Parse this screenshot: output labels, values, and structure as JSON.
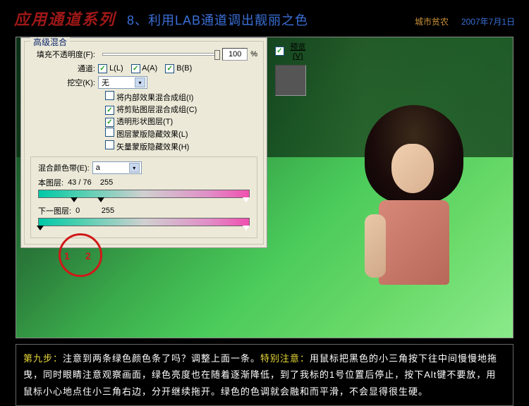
{
  "header": {
    "title_red": "应用通道系列",
    "title_blue": "8、利用LAB通道调出靓丽之色",
    "author": "城市贫农",
    "date": "2007年7月1日"
  },
  "dialog": {
    "group_title": "高级混合",
    "preview_label": "预览(V)",
    "fill_opacity_label": "填充不透明度(F):",
    "fill_opacity_value": "100",
    "percent": "%",
    "channels_label": "通道:",
    "ch_l": "L(L)",
    "ch_a": "A(A)",
    "ch_b": "B(B)",
    "knockout_label": "挖空(K):",
    "knockout_value": "无",
    "opt1": "将内部效果混合成组(I)",
    "opt2": "将剪贴图层混合成组(C)",
    "opt3": "透明形状图层(T)",
    "opt4": "图层蒙版隐藏效果(L)",
    "opt5": "矢量蒙版隐藏效果(H)",
    "blend_if_label": "混合颜色带(E):",
    "blend_if_value": "a",
    "this_layer": "本图层:",
    "this_vals": "43 / 76    255",
    "under_layer": "下一图层:",
    "under_vals": "0          255"
  },
  "annotations": {
    "m1": "1",
    "m2": "2"
  },
  "footer": {
    "step": "第九步：",
    "text1": "注意到两条绿色颜色条了吗？调整上面一条。",
    "warn": "特别注意：",
    "text2": "用鼠标把黑色的小三角按下往中间慢慢地拖曳，同时眼睛注意观察画面，绿色亮度也在随着逐渐降低，到了我标的1号位置后停止，按下Alt键不要放，用鼠标小心地点住小三角右边，分开继续拖开。绿色的色调就会融和而平滑，不会显得很生硬。"
  }
}
